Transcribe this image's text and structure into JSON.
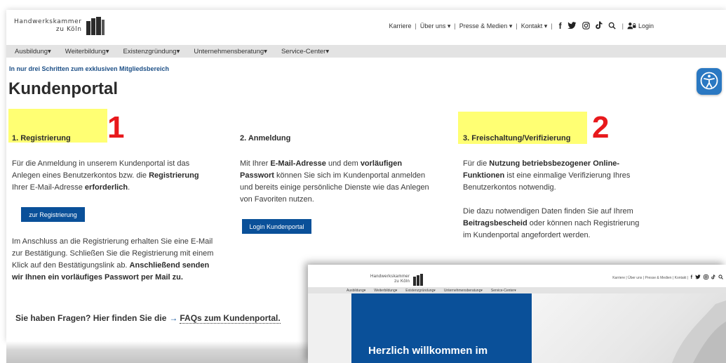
{
  "header": {
    "logo_line1": "Handwerkskammer",
    "logo_line2": "zu Köln",
    "links": [
      "Karriere",
      "Über uns",
      "Presse & Medien",
      "Kontakt"
    ],
    "login_label": "Login"
  },
  "nav": {
    "items": [
      "Ausbildung",
      "Weiterbildung",
      "Existenzgründung",
      "Unternehmensberatung",
      "Service-Center"
    ]
  },
  "page": {
    "teaser": "In nur drei Schritten zum exklusiven Mitgliedsbereich",
    "title": "Kundenportal"
  },
  "steps": [
    {
      "heading": "1. Registrierung",
      "annotation": "1",
      "p1": {
        "t1": "Für die Anmeldung in unserem Kundenportal ist das Anlegen eines Benutzerkontos bzw. die ",
        "b1": "Registrierung",
        "t2": " Ihrer E-Mail-Adresse ",
        "b2": "erforderlich",
        "t3": "."
      },
      "button": "zur Registrierung",
      "p2": {
        "t1": "Im Anschluss an die Registrierung erhalten Sie eine E-Mail zur Bestätigung. Schließen Sie die Registrierung mit einem Klick auf den Bestätigungslink ab. ",
        "b1": "Anschließend senden wir Ihnen ein vorläufiges Passwort per Mail zu."
      }
    },
    {
      "heading": "2. Anmeldung",
      "p1": {
        "t1": "Mit Ihrer ",
        "b1": "E-Mail-Adresse",
        "t2": " und dem ",
        "b2": "vorläufigen Passwort",
        "t3": " können Sie sich im Kundenportal anmelden und bereits einige persönliche Dienste wie das Anlegen von Favoriten nutzen."
      },
      "button": "Login Kundenportal"
    },
    {
      "heading": "3. Freischaltung/Verifizierung",
      "annotation": "2",
      "p1": {
        "t1": "Für die ",
        "b1": "Nutzung betriebsbezogener Online-Funktionen",
        "t2": " ist eine einmalige Verifizierung Ihres Benutzerkontos notwendig."
      },
      "p2": {
        "t1": "Die dazu notwendigen Daten finden Sie auf Ihrem ",
        "b1": "Beitragsbescheid",
        "t2": " oder können nach Registrierung im Kundenportal angefordert werden."
      }
    }
  ],
  "faq": {
    "prefix": "Sie haben Fragen? Hier finden Sie die",
    "link": "FAQs zum Kundenportal."
  },
  "overlay": {
    "logo_line1": "Handwerkskammer",
    "logo_line2": "zu Köln",
    "links": [
      "Karriere",
      "Über uns",
      "Presse & Medien",
      "Kontakt"
    ],
    "nav": [
      "Ausbildung",
      "Weiterbildung",
      "Existenzgründung",
      "Unternehmensberatung",
      "Service-Center"
    ],
    "welcome": "Herzlich willkommen im"
  },
  "colors": {
    "brand_blue": "#0a5099",
    "highlight": "#ffff5a",
    "annotation_red": "#e8191c",
    "teaser_blue": "#1c4f86",
    "a11y_blue": "#2a78c2"
  },
  "icons": [
    "facebook-icon",
    "twitter-icon",
    "instagram-icon",
    "tiktok-icon",
    "search-icon",
    "login-user-icon",
    "accessibility-icon",
    "chevron-down-icon",
    "arrow-right-icon"
  ]
}
